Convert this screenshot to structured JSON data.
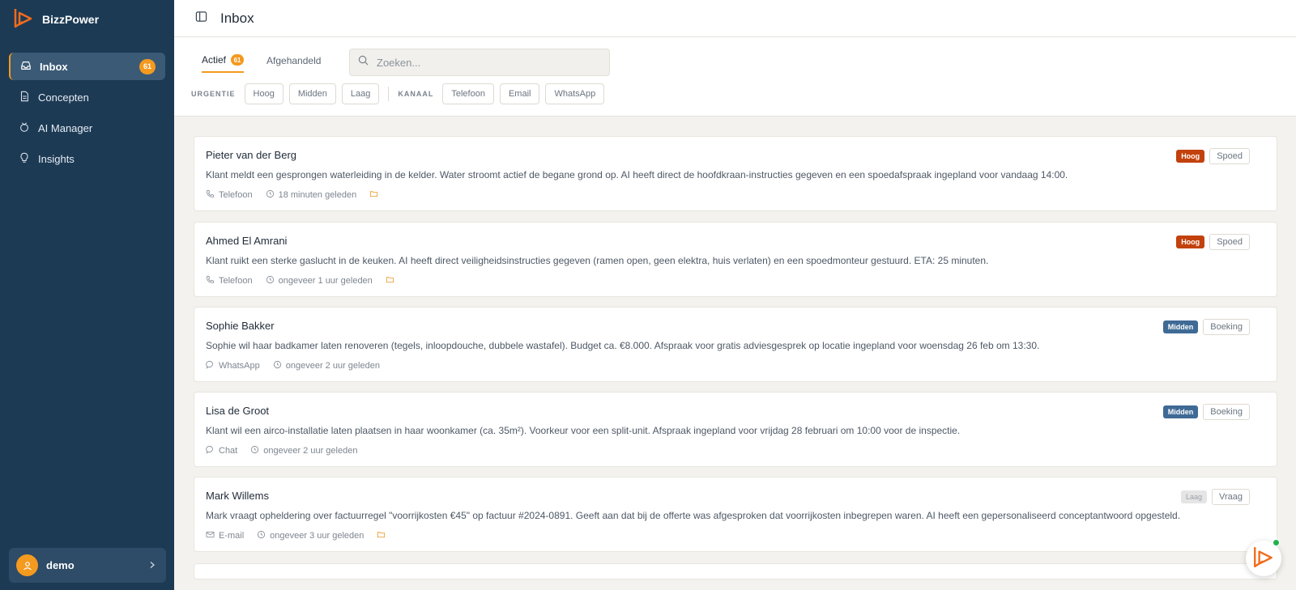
{
  "app": {
    "name": "BizzPower"
  },
  "sidebar": {
    "items": [
      {
        "label": "Inbox",
        "icon": "inbox-icon",
        "active": true,
        "badge": "61"
      },
      {
        "label": "Concepten",
        "icon": "document-icon"
      },
      {
        "label": "AI Manager",
        "icon": "ai-manager-icon"
      },
      {
        "label": "Insights",
        "icon": "lightbulb-icon"
      }
    ],
    "user": {
      "name": "demo"
    }
  },
  "header": {
    "title": "Inbox"
  },
  "toolbar": {
    "tabs": [
      {
        "label": "Actief",
        "badge": "61",
        "active": true
      },
      {
        "label": "Afgehandeld"
      }
    ],
    "search": {
      "placeholder": "Zoeken..."
    },
    "filters": {
      "urgency_label": "URGENTIE",
      "urgency": [
        "Hoog",
        "Midden",
        "Laag"
      ],
      "channel_label": "KANAAL",
      "channel": [
        "Telefoon",
        "Email",
        "WhatsApp"
      ]
    }
  },
  "colors": {
    "hoog": "#c2410c",
    "midden": "#3f6a95",
    "laag": "#e5e5e5",
    "accent": "#f39a1f",
    "sidebar": "#1d3a55"
  },
  "messages": [
    {
      "name": "Pieter van der Berg",
      "text": "Klant meldt een gesprongen waterleiding in de kelder. Water stroomt actief de begane grond op. AI heeft direct de hoofdkraan-instructies gegeven en een spoedafspraak ingepland voor vandaag 14:00.",
      "channel": "Telefoon",
      "channel_icon": "phone-icon",
      "time": "18 minuten geleden",
      "has_draft": true,
      "urgency": "Hoog",
      "type": "Spoed"
    },
    {
      "name": "Ahmed El Amrani",
      "text": "Klant ruikt een sterke gaslucht in de keuken. AI heeft direct veiligheidsinstructies gegeven (ramen open, geen elektra, huis verlaten) en een spoedmonteur gestuurd. ETA: 25 minuten.",
      "channel": "Telefoon",
      "channel_icon": "phone-icon",
      "time": "ongeveer 1 uur geleden",
      "has_draft": true,
      "urgency": "Hoog",
      "type": "Spoed"
    },
    {
      "name": "Sophie Bakker",
      "text": "Sophie wil haar badkamer laten renoveren (tegels, inloopdouche, dubbele wastafel). Budget ca. €8.000. Afspraak voor gratis adviesgesprek op locatie ingepland voor woensdag 26 feb om 13:30.",
      "channel": "WhatsApp",
      "channel_icon": "chat-bubble-icon",
      "time": "ongeveer 2 uur geleden",
      "has_draft": false,
      "urgency": "Midden",
      "type": "Boeking"
    },
    {
      "name": "Lisa de Groot",
      "text": "Klant wil een airco-installatie laten plaatsen in haar woonkamer (ca. 35m²). Voorkeur voor een split-unit. Afspraak ingepland voor vrijdag 28 februari om 10:00 voor de inspectie.",
      "channel": "Chat",
      "channel_icon": "chat-bubble-icon",
      "time": "ongeveer 2 uur geleden",
      "has_draft": false,
      "urgency": "Midden",
      "type": "Boeking"
    },
    {
      "name": "Mark Willems",
      "text": "Mark vraagt opheldering over factuurregel \"voorrijkosten €45\" op factuur #2024-0891. Geeft aan dat bij de offerte was afgesproken dat voorrijkosten inbegrepen waren. AI heeft een gepersonaliseerd conceptantwoord opgesteld.",
      "channel": "E-mail",
      "channel_icon": "mail-icon",
      "time": "ongeveer 3 uur geleden",
      "has_draft": true,
      "urgency": "Laag",
      "type": "Vraag"
    }
  ]
}
